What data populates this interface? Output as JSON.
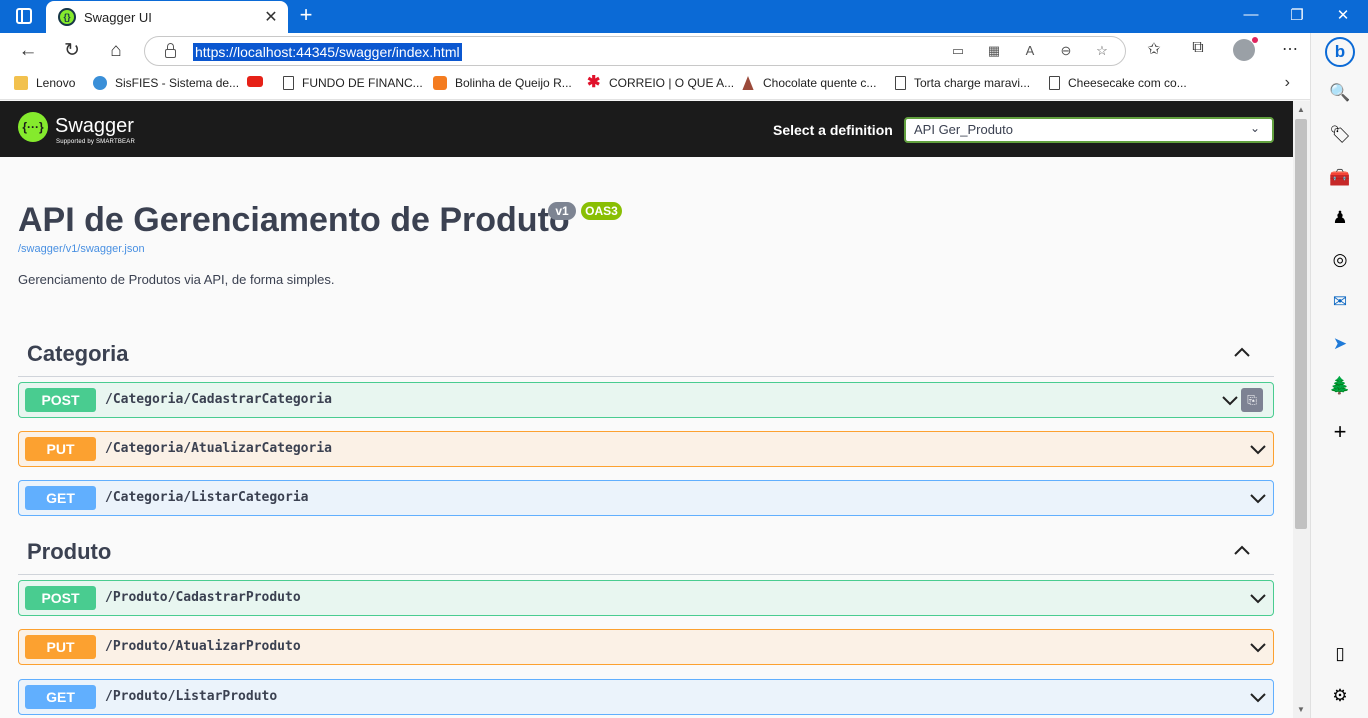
{
  "browser": {
    "tab_title": "Swagger UI",
    "tab_favicon": "{}",
    "tab_close": "✕",
    "new_tab": "+",
    "url": "https://localhost:44345/swagger/index.html",
    "window_controls": {
      "minimize": "—",
      "maximize": "❐",
      "close": "✕"
    },
    "nav": {
      "back": "←",
      "refresh": "↻",
      "home": "⌂"
    },
    "url_icons": [
      "▭",
      "▦",
      "A",
      "⊖",
      "☆"
    ],
    "toolbar_icons": [
      "✩",
      "⧉",
      "⋯"
    ],
    "bookmarks": [
      {
        "label": "Lenovo",
        "icon": "folder-icon"
      },
      {
        "label": "SisFIES - Sistema de...",
        "icon": "sisfies-icon"
      },
      {
        "label": "",
        "icon": "youtube-icon"
      },
      {
        "label": "FUNDO DE FINANC...",
        "icon": "page-icon"
      },
      {
        "label": "Bolinha de Queijo R...",
        "icon": "recipe-icon"
      },
      {
        "label": "CORREIO | O QUE A...",
        "icon": "correio-icon"
      },
      {
        "label": "Chocolate quente c...",
        "icon": "tower-icon"
      },
      {
        "label": "Torta charge maravi...",
        "icon": "page-icon"
      },
      {
        "label": "Cheesecake com co...",
        "icon": "page-icon"
      }
    ],
    "bookmarks_overflow": "›",
    "sidebar_icons": [
      "b",
      "🔍",
      "🏷",
      "🧰",
      "♟",
      "◎",
      "✉",
      "➤",
      "🌲",
      "+",
      "▯",
      "⚙"
    ]
  },
  "swagger": {
    "logo_glyph": "{···}",
    "logo_name": "Swagger",
    "logo_sub": "Supported by SMARTBEAR",
    "definition_label": "Select a definition",
    "definition_value": "API Ger_Produto",
    "definition_arrow": "⌄",
    "title": "API de Gerenciamento de Produto",
    "version_badge": "v1",
    "oas_badge": "OAS3",
    "spec_link": "/swagger/v1/swagger.json",
    "description": "Gerenciamento de Produtos via API, de forma simples.",
    "copy_glyph": "⎘",
    "tags": [
      {
        "name": "Categoria",
        "operations": [
          {
            "method": "POST",
            "path": "/Categoria/CadastrarCategoria"
          },
          {
            "method": "PUT",
            "path": "/Categoria/AtualizarCategoria"
          },
          {
            "method": "GET",
            "path": "/Categoria/ListarCategoria"
          }
        ]
      },
      {
        "name": "Produto",
        "operations": [
          {
            "method": "POST",
            "path": "/Produto/CadastrarProduto"
          },
          {
            "method": "PUT",
            "path": "/Produto/AtualizarProduto"
          },
          {
            "method": "GET",
            "path": "/Produto/ListarProduto"
          }
        ]
      }
    ]
  },
  "colors": {
    "post": "#49cc90",
    "put": "#fca130",
    "get": "#61affe",
    "swagger_green": "#85ea2d",
    "topbar": "#1b1b1b",
    "browser_accent": "#0b6ad6"
  }
}
